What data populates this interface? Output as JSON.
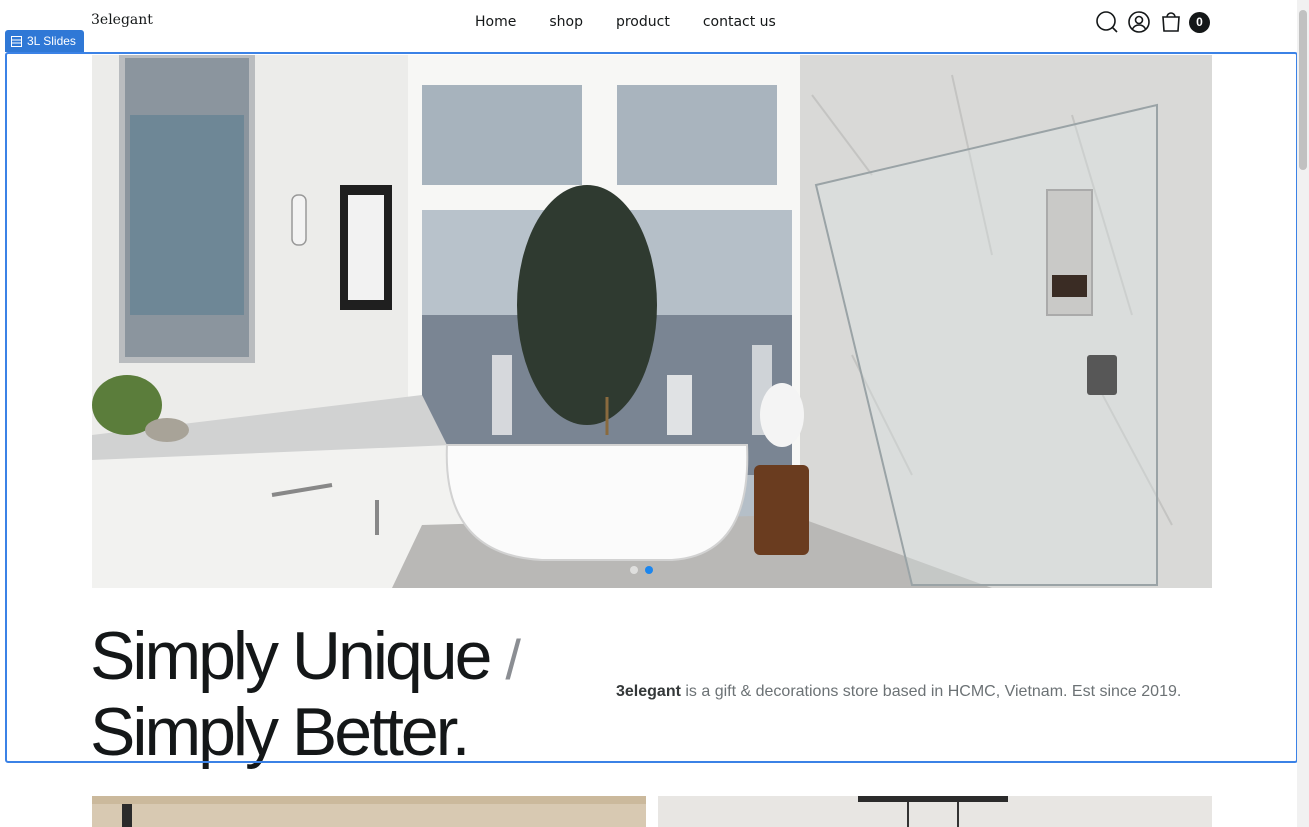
{
  "header": {
    "logo": "3elegant",
    "nav": [
      "Home",
      "shop",
      "product",
      "contact us"
    ],
    "cart_count": "0"
  },
  "editor": {
    "tag_label": "3L Slides"
  },
  "hero": {
    "slides_total": 2,
    "active_slide": 2
  },
  "intro": {
    "headline_line1": "Simply Unique",
    "slash": "/",
    "headline_line2": "Simply Better.",
    "brand": "3elegant",
    "tagline": " is a gift & decorations store based in HCMC, Vietnam. Est since 2019."
  },
  "icons": [
    "search-icon",
    "user-icon",
    "shopping-bag-icon",
    "slides-icon"
  ],
  "colors": {
    "accent": "#1c86ee",
    "selection": "#3b82e6",
    "text": "#141718",
    "muted": "#6c7275"
  }
}
